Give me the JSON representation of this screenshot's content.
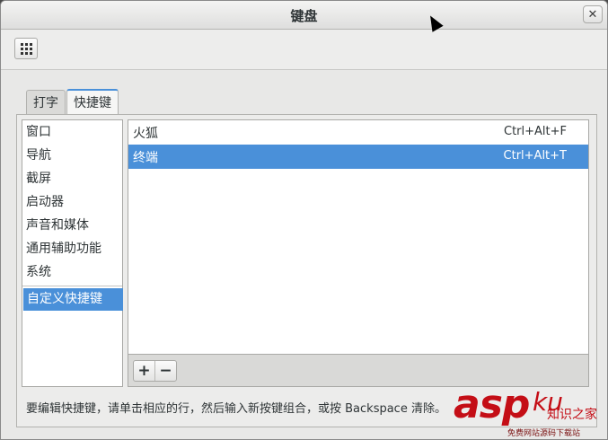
{
  "window": {
    "title": "键盘",
    "close_glyph": "✕"
  },
  "toolbar": {
    "menu_icon": "grid-icon"
  },
  "tabs": [
    {
      "label": "打字",
      "active": false
    },
    {
      "label": "快捷键",
      "active": true
    }
  ],
  "categories": [
    {
      "label": "窗口"
    },
    {
      "label": "导航"
    },
    {
      "label": "截屏"
    },
    {
      "label": "启动器"
    },
    {
      "label": "声音和媒体"
    },
    {
      "label": "通用辅助功能"
    },
    {
      "label": "系统"
    }
  ],
  "selected_category": {
    "label": "自定义快捷键"
  },
  "shortcuts": [
    {
      "name": "火狐",
      "keys": "Ctrl+Alt+F",
      "selected": false
    },
    {
      "name": "终端",
      "keys": "Ctrl+Alt+T",
      "selected": true
    }
  ],
  "list_toolbar": {
    "add_label": "+",
    "remove_label": "−"
  },
  "hint": "要编辑快捷键，请单击相应的行，然后输入新按键组合，或按 Backspace 清除。",
  "colors": {
    "accent": "#4a90d9",
    "watermark": "#c40e16"
  },
  "watermark": {
    "main": "asp",
    "ku": "ku",
    "sub": "知识之家",
    "foot": "免费网站源码下载站"
  }
}
